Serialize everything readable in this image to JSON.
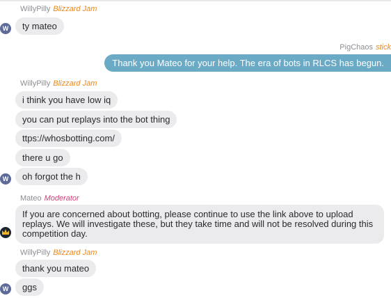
{
  "colors": {
    "blizzard_tag": "#e8871e",
    "moderator_tag": "#d63e7c",
    "own_bubble": "#6aaac4",
    "other_bubble": "#ebebed"
  },
  "messages": {
    "g1": {
      "user": "WillyPilly",
      "tag": "Blizzard Jam",
      "avatar_letter": "W",
      "lines": [
        "ty mateo"
      ]
    },
    "g2": {
      "user": "PigChaos",
      "tag": "stick",
      "lines": [
        "Thank you Mateo for your help. The era of bots in RLCS has begun."
      ]
    },
    "g3": {
      "user": "WillyPilly",
      "tag": "Blizzard Jam",
      "avatar_letter": "W",
      "lines": [
        "i think you have low iq",
        "you can put replays into the bot thing",
        "ttps://whosbotting.com/",
        "there u go",
        "oh forgot the h"
      ]
    },
    "g4": {
      "user": "Mateo",
      "tag": "Moderator",
      "avatar_icon": "crown-icon",
      "lines": [
        "If you are concerned about botting, please continue to use the link above to upload replays. We will investigate these, but they take time and will not be resolved during this competition day."
      ]
    },
    "g5": {
      "user": "WillyPilly",
      "tag": "Blizzard Jam",
      "avatar_letter": "W",
      "lines": [
        "thank you mateo",
        "ggs"
      ]
    }
  }
}
